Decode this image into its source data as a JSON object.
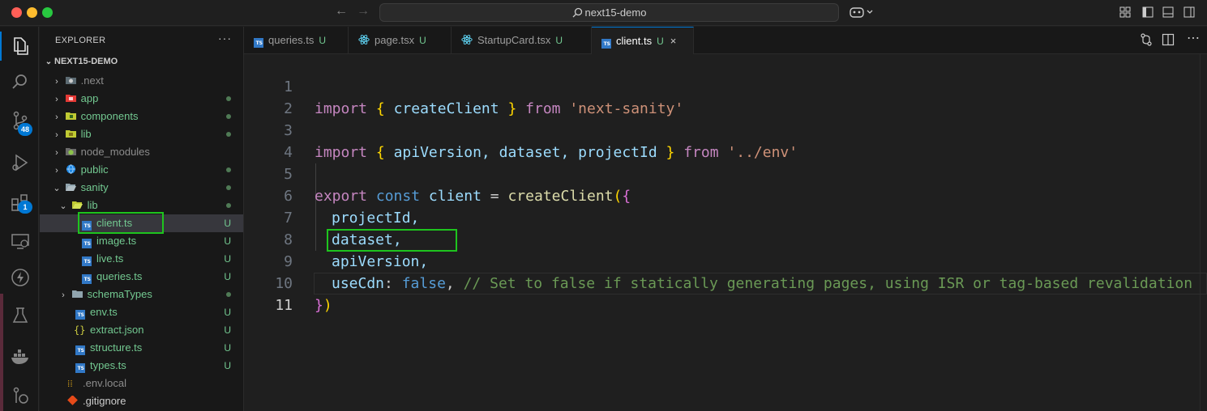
{
  "window": {
    "search_text": "next15-demo"
  },
  "activity_bar": {
    "source_control_badge": "48",
    "extensions_badge": "1"
  },
  "explorer": {
    "title": "EXPLORER",
    "more": "···",
    "root": "NEXT15-DEMO",
    "items": [
      {
        "label": ".next",
        "decoration": ""
      },
      {
        "label": "app",
        "decoration": "dot"
      },
      {
        "label": "components",
        "decoration": "dot"
      },
      {
        "label": "lib",
        "decoration": "dot"
      },
      {
        "label": "node_modules",
        "decoration": ""
      },
      {
        "label": "public",
        "decoration": "dot"
      },
      {
        "label": "sanity",
        "decoration": "dot"
      },
      {
        "label": "lib",
        "decoration": "dot"
      },
      {
        "label": "client.ts",
        "decoration": "U"
      },
      {
        "label": "image.ts",
        "decoration": "U"
      },
      {
        "label": "live.ts",
        "decoration": "U"
      },
      {
        "label": "queries.ts",
        "decoration": "U"
      },
      {
        "label": "schemaTypes",
        "decoration": "dot"
      },
      {
        "label": "env.ts",
        "decoration": "U"
      },
      {
        "label": "extract.json",
        "decoration": "U"
      },
      {
        "label": "structure.ts",
        "decoration": "U"
      },
      {
        "label": "types.ts",
        "decoration": "U"
      },
      {
        "label": ".env.local",
        "decoration": ""
      },
      {
        "label": ".gitignore",
        "decoration": ""
      }
    ]
  },
  "tabs": [
    {
      "label": "queries.ts",
      "status": "U"
    },
    {
      "label": "page.tsx",
      "status": "U"
    },
    {
      "label": "StartupCard.tsx",
      "status": "U"
    },
    {
      "label": "client.ts",
      "status": "U",
      "close": "×"
    }
  ],
  "editor": {
    "line_numbers": [
      "1",
      "2",
      "3",
      "4",
      "5",
      "6",
      "7",
      "8",
      "9",
      "10",
      "11"
    ],
    "line1": {
      "kw": "import",
      "open": "{",
      "name": "createClient",
      "close": "}",
      "from": "from",
      "module": "'next-sanity'"
    },
    "line3": {
      "kw": "import",
      "open": "{",
      "names": "apiVersion, dataset, projectId",
      "close": "}",
      "from": "from",
      "module": "'../env'"
    },
    "line5": {
      "export": "export",
      "const": "const",
      "name": "client",
      "eq": "=",
      "fn": "createClient",
      "open": "(",
      "brace": "{"
    },
    "line6": "projectId,",
    "line7": "dataset,",
    "line8": "apiVersion,",
    "line9": {
      "key": "useCdn",
      "colon": ":",
      "value": "false",
      "comma": ",",
      "comment": "// Set to false if statically generating pages, using ISR or tag-based revalidation"
    },
    "line10": {
      "brace": "}",
      "paren": ")"
    }
  }
}
